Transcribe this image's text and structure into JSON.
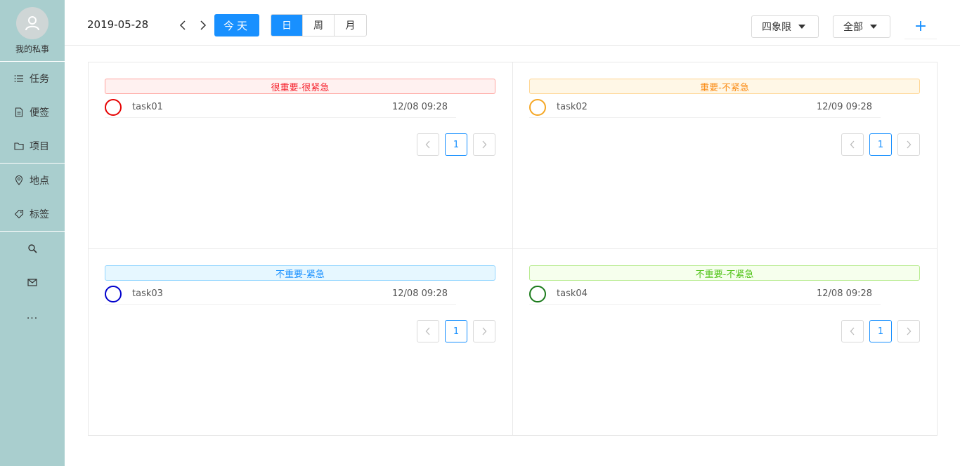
{
  "sidebar": {
    "profile_name": "我的私事",
    "items": [
      {
        "label": "任务",
        "icon": "list-icon"
      },
      {
        "label": "便签",
        "icon": "note-icon"
      },
      {
        "label": "项目",
        "icon": "folder-icon"
      },
      {
        "label": "地点",
        "icon": "location-icon"
      },
      {
        "label": "标签",
        "icon": "tag-icon"
      }
    ],
    "more": "..."
  },
  "header": {
    "date": "2019-05-28",
    "today": "今天",
    "views": [
      "日",
      "周",
      "月"
    ],
    "active_view": "日",
    "quadrant_dropdown": "四象限",
    "filter_dropdown": "全部",
    "add": "+"
  },
  "quadrants": [
    {
      "title": "很重要-很紧急",
      "color": "#f5222d",
      "bg": "#fff1f0",
      "border": "#ffa39e",
      "task": {
        "name": "task01",
        "time": "12/08 09:28",
        "circle": "#e60000"
      },
      "page": "1"
    },
    {
      "title": "重要-不紧急",
      "color": "#fa8c16",
      "bg": "#fff7e6",
      "border": "#ffd591",
      "task": {
        "name": "task02",
        "time": "12/09 09:28",
        "circle": "#f5a623"
      },
      "page": "1"
    },
    {
      "title": "不重要-紧急",
      "color": "#1890ff",
      "bg": "#e6f7ff",
      "border": "#91d5ff",
      "task": {
        "name": "task03",
        "time": "12/08 09:28",
        "circle": "#0000cc"
      },
      "page": "1"
    },
    {
      "title": "不重要-不紧急",
      "color": "#52c41a",
      "bg": "#f6ffed",
      "border": "#b7eb8f",
      "task": {
        "name": "task04",
        "time": "12/08 09:28",
        "circle": "#1a7a1a"
      },
      "page": "1"
    }
  ]
}
